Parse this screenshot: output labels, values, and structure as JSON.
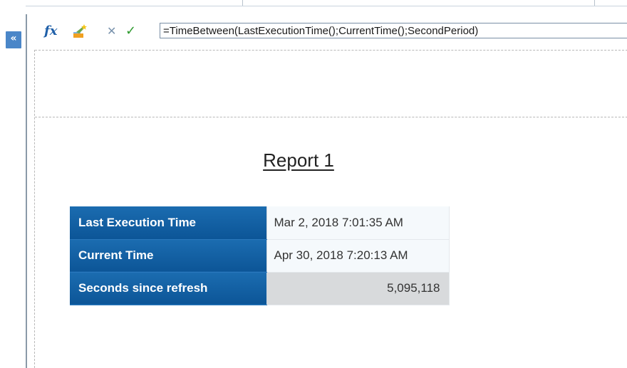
{
  "collapse_button": {
    "label": "«"
  },
  "toolbar": {
    "fx_label": "fx",
    "cancel_label": "✕",
    "confirm_label": "✓",
    "formula": "=TimeBetween(LastExecutionTime();CurrentTime();SecondPeriod)"
  },
  "report": {
    "title": "Report 1",
    "rows": [
      {
        "label": "Last Execution Time",
        "value": "Mar 2, 2018 7:01:35 AM"
      },
      {
        "label": "Current Time",
        "value": "Apr 30, 2018 7:20:13 AM"
      },
      {
        "label": "Seconds since refresh",
        "value": "5,095,118"
      }
    ]
  },
  "colors": {
    "header_cell": "#0c5597",
    "accent": "#4a86c8",
    "confirm": "#2e9a2e"
  },
  "icons": [
    "fx-icon",
    "magic-wand-icon",
    "cancel-icon",
    "check-icon",
    "collapse-icon"
  ]
}
